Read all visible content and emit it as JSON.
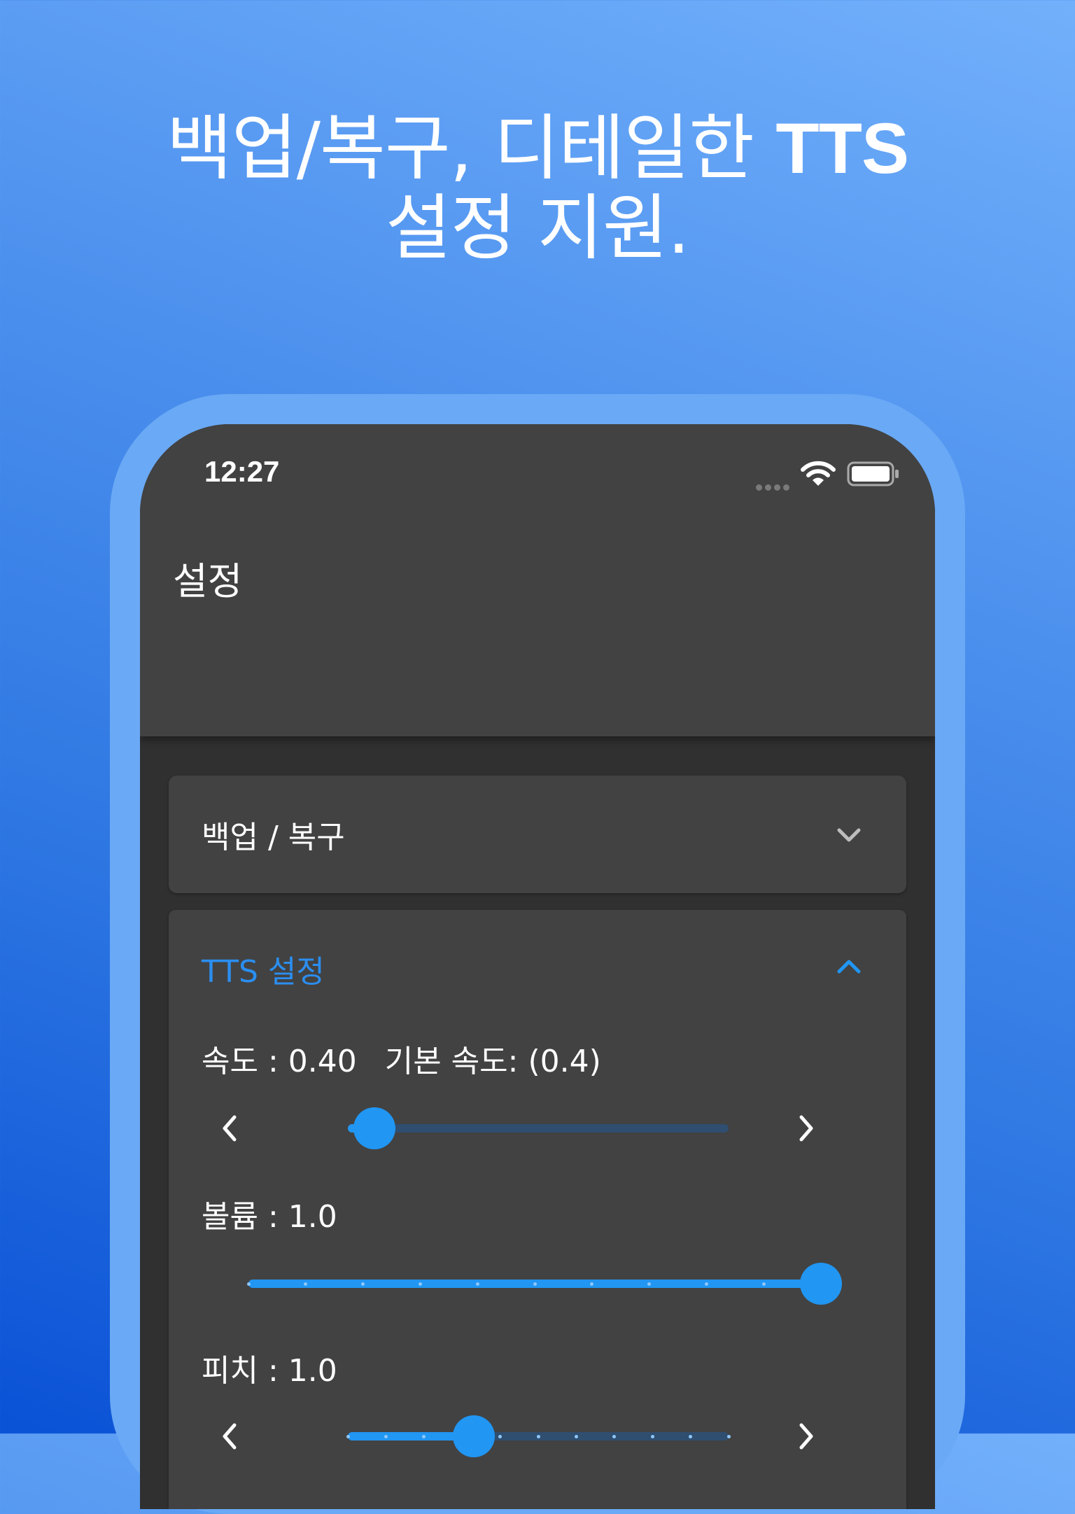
{
  "headline": {
    "line1_prefix": "백업/복구, 디테일한 ",
    "line1_bold": "TTS",
    "line2": "설정 지원."
  },
  "status_bar": {
    "time": "12:27"
  },
  "app_bar": {
    "title": "설정"
  },
  "panels": {
    "backup": {
      "title": "백업 / 복구",
      "expanded": false,
      "icon": "chevron-down-icon"
    },
    "tts": {
      "title": "TTS 설정",
      "expanded": true,
      "icon": "chevron-up-icon",
      "speed": {
        "label": "속도 : 0.40",
        "default_label": "기본 속도: (0.4)",
        "value": 0.4,
        "fill_fraction": 0.07
      },
      "volume": {
        "label": "볼륨 : 1.0",
        "value": 1.0,
        "fill_fraction": 1.0
      },
      "pitch": {
        "label": "피치 : 1.0",
        "value": 1.0,
        "fill_fraction": 0.33
      }
    }
  },
  "colors": {
    "accent": "#2196f3",
    "accent_text": "#2b8ef0",
    "appbar": "#424242",
    "background": "#303030",
    "device_frame": "#6aa9f5"
  }
}
